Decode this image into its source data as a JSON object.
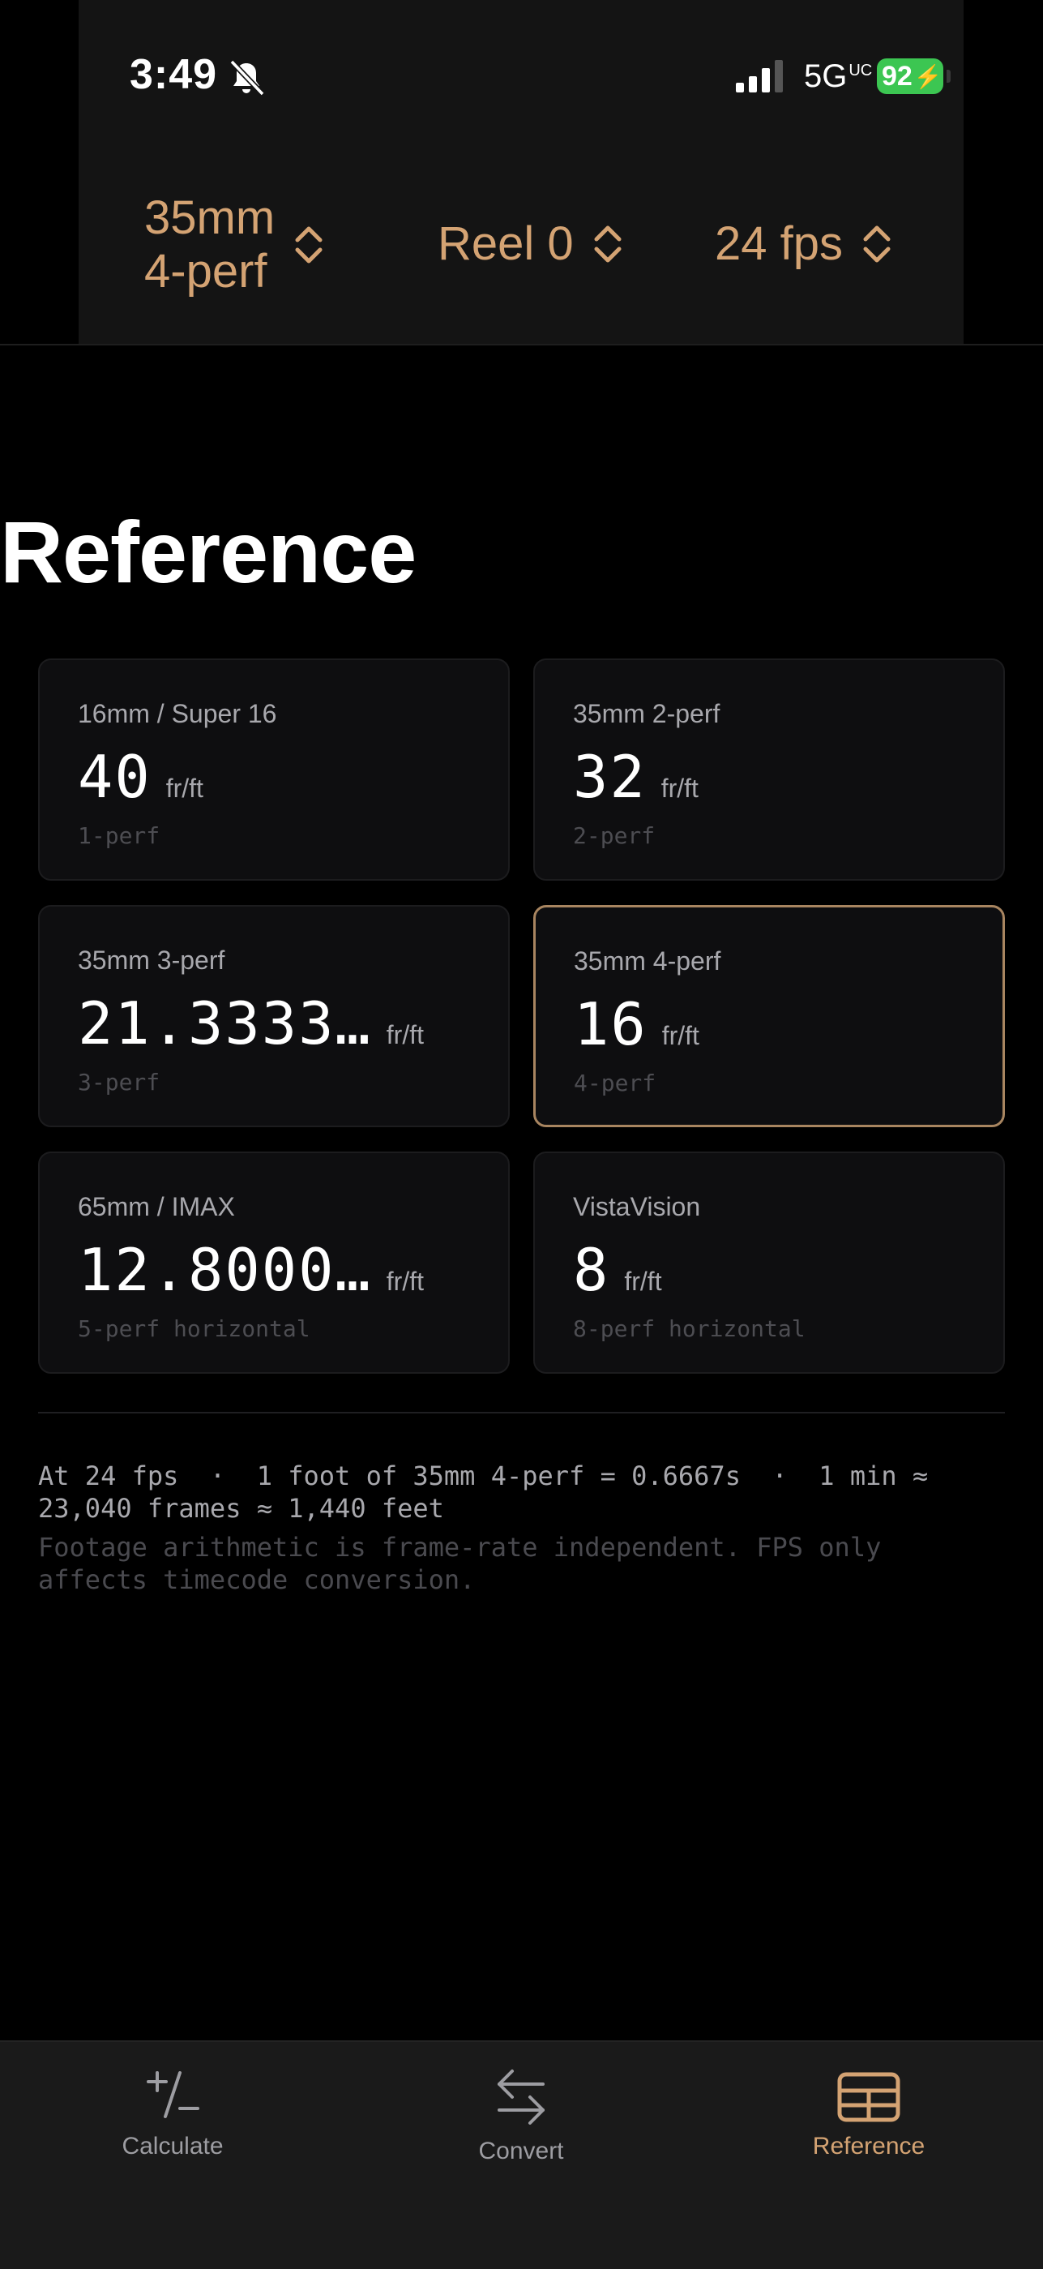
{
  "status_bar": {
    "time": "3:49",
    "network": "5G",
    "network_suffix": "UC",
    "battery": "92"
  },
  "toolbar": {
    "format_line1": "35mm",
    "format_line2": "4-perf",
    "reel": "Reel 0",
    "fps": "24 fps"
  },
  "page_title": "Reference",
  "formats": [
    {
      "name": "16mm / Super 16",
      "value": "40",
      "unit": "fr/ft",
      "perf": "1-perf",
      "selected": false
    },
    {
      "name": "35mm 2-perf",
      "value": "32",
      "unit": "fr/ft",
      "perf": "2-perf",
      "selected": false
    },
    {
      "name": "35mm 3-perf",
      "value": "21.3333…",
      "unit": "fr/ft",
      "perf": "3-perf",
      "selected": false
    },
    {
      "name": "35mm 4-perf",
      "value": "16",
      "unit": "fr/ft",
      "perf": "4-perf",
      "selected": true
    },
    {
      "name": "65mm / IMAX",
      "value": "12.8000…",
      "unit": "fr/ft",
      "perf": "5-perf horizontal",
      "selected": false
    },
    {
      "name": "VistaVision",
      "value": "8",
      "unit": "fr/ft",
      "perf": "8-perf horizontal",
      "selected": false
    }
  ],
  "info": "At 24 fps  ·  1 foot of 35mm 4-perf = 0.6667s  ·  1 min ≈ 23,040 frames ≈ 1,440 feet",
  "note": "Footage arithmetic is frame-rate independent. FPS only affects timecode conversion.",
  "tabs": [
    {
      "label": "Calculate",
      "icon": "plus-minus-icon",
      "active": false
    },
    {
      "label": "Convert",
      "icon": "swap-arrows-icon",
      "active": false
    },
    {
      "label": "Reference",
      "icon": "table-grid-icon",
      "active": true
    }
  ],
  "colors": {
    "accent": "#d4a373",
    "selected_border": "#a88560",
    "battery": "#3cc652",
    "background": "#000000"
  }
}
